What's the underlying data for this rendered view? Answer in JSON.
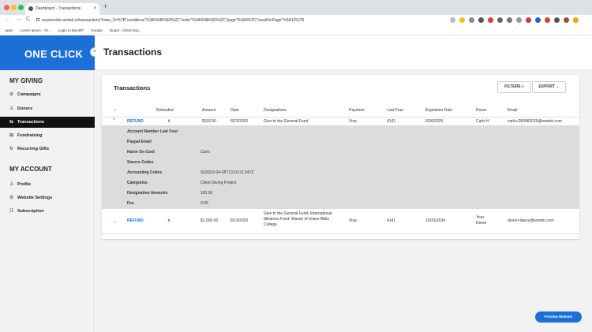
{
  "browser": {
    "tab_title": "Dashboard - Transactions",
    "tab_close": "×",
    "new_tab": "+",
    "nav_back": "←",
    "nav_forward": "→",
    "nav_reload": "C",
    "url": "myoneclick.wmtek.io/transactions?view_2=%7B\"conditions\"%3A%5B%5D%2C\"order\"%3A%5B%5D%2C\"page\"%3A0%2C\"rowsPerPage\"%3A10%7D",
    "bookmarks": [
      "Apps",
      "Lorem Ipsum - All...",
      "Login to MyADP",
      "Google",
      "Board - Client Exp..."
    ]
  },
  "sidebar": {
    "logo": "ONE CLICK",
    "collapse_icon": "≡",
    "section_giving": "MY GIVING",
    "section_account": "MY ACCOUNT",
    "giving_items": [
      {
        "label": "Campaigns",
        "icon": "⊙"
      },
      {
        "label": "Donors",
        "icon": "♙"
      },
      {
        "label": "Transactions",
        "icon": "⇆"
      },
      {
        "label": "Fundraising",
        "icon": "⊞"
      },
      {
        "label": "Recurring Gifts",
        "icon": "↻"
      }
    ],
    "account_items": [
      {
        "label": "Profile",
        "icon": "♙"
      },
      {
        "label": "Website Settings",
        "icon": "⚙"
      },
      {
        "label": "Subscription",
        "icon": "☷"
      }
    ]
  },
  "header": {
    "title": "Transactions"
  },
  "card": {
    "title": "Transactions",
    "filters_label": "FILTERS",
    "filters_icon": "≡",
    "export_label": "EXPORT",
    "export_icon": "⌄"
  },
  "table": {
    "headers": {
      "refunded": "Refunded",
      "amount": "Amount",
      "date": "Date",
      "designations": "Designations",
      "payment": "Payment",
      "last_four": "Last Four",
      "expiration": "Expiration Date",
      "donor": "Donor",
      "email": "Email"
    },
    "header_chevron": "⌄",
    "rows": [
      {
        "chevron": "^",
        "refund": "REFUND",
        "refunded_mark": "✗",
        "amount": "$100.00",
        "date": "8/23/2020",
        "designations": "Give to the General Fund",
        "payment": "Visa",
        "last_four": "4141",
        "expiration": "6/30/2026",
        "donor": "Carls H",
        "email": "carls+280082020@wmtek.com"
      },
      {
        "chevron": "⌄",
        "refund": "REFUND",
        "refunded_mark": "✗",
        "amount": "$1,500.00",
        "date": "8/19/2020",
        "designations": "Give to the General Fund, International Missions Fund, Waves of Grace Bible College",
        "payment": "Visa",
        "last_four": "4141",
        "expiration": "10/31/2034",
        "donor": "Your Donor",
        "email": "donor+darey@wmtek.com"
      }
    ],
    "detail": [
      {
        "label": "Account Number Last Four",
        "value": ""
      },
      {
        "label": "Paypal Email",
        "value": ""
      },
      {
        "label": "Name On Card",
        "value": "Carls"
      },
      {
        "label": "Source Codes",
        "value": ""
      },
      {
        "label": "Accounting Codes",
        "value": "SS2023-04-28T13:15:21.547Z"
      },
      {
        "label": "Categories",
        "value": "Client Giving Project"
      },
      {
        "label": "Designation Amounts",
        "value": "100.00"
      },
      {
        "label": "Fee",
        "value": "0.00"
      }
    ]
  },
  "preview_button": "Preview Website"
}
